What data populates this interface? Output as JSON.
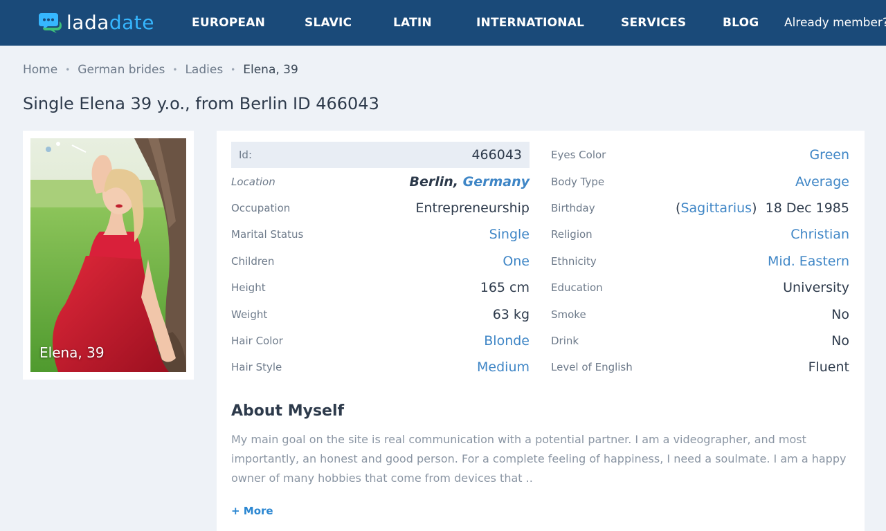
{
  "header": {
    "logo_part1": "lada",
    "logo_part2": "date",
    "nav": [
      "EUROPEAN",
      "SLAVIC",
      "LATIN",
      "INTERNATIONAL",
      "SERVICES",
      "BLOG"
    ],
    "member_link": "Already member?",
    "colors": {
      "background": "#1a4a79",
      "logo_accent": "#36b7ff"
    }
  },
  "breadcrumb": [
    "Home",
    "German brides",
    "Ladies",
    "Elena, 39"
  ],
  "page_title": "Single Elena 39 y.o., from Berlin ID 466043",
  "photo": {
    "caption": "Elena, 39"
  },
  "profile": {
    "left": [
      {
        "label": "Id:",
        "value": "466043"
      },
      {
        "label": "Location",
        "city": "Berlin,",
        "country": "Germany"
      },
      {
        "label": "Occupation",
        "value": "Entrepreneurship"
      },
      {
        "label": "Marital Status",
        "value": "Single"
      },
      {
        "label": "Children",
        "value": "One"
      },
      {
        "label": "Height",
        "value": "165 cm"
      },
      {
        "label": "Weight",
        "value": "63 kg"
      },
      {
        "label": "Hair Color",
        "value": "Blonde"
      },
      {
        "label": "Hair Style",
        "value": "Medium"
      }
    ],
    "right": [
      {
        "label": "Eyes Color",
        "value": "Green"
      },
      {
        "label": "Body Type",
        "value": "Average"
      },
      {
        "label": "Birthday",
        "zodiac": "Sagittarius",
        "value": "18 Dec 1985"
      },
      {
        "label": "Religion",
        "value": "Christian"
      },
      {
        "label": "Ethnicity",
        "value": "Mid. Eastern"
      },
      {
        "label": "Education",
        "value": "University"
      },
      {
        "label": "Smoke",
        "value": "No"
      },
      {
        "label": "Drink",
        "value": "No"
      },
      {
        "label": "Level of English",
        "value": "Fluent"
      }
    ]
  },
  "about": {
    "title": "About Myself",
    "text": "My main goal on the site is real communication with a potential partner. I am a videographer, and most importantly, an honest and good person. For a complete feeling of happiness, I need a soulmate. I am a happy owner of many hobbies that come from devices that ..",
    "more": "+ More"
  },
  "icons": [
    "chat-bubbles-icon"
  ]
}
